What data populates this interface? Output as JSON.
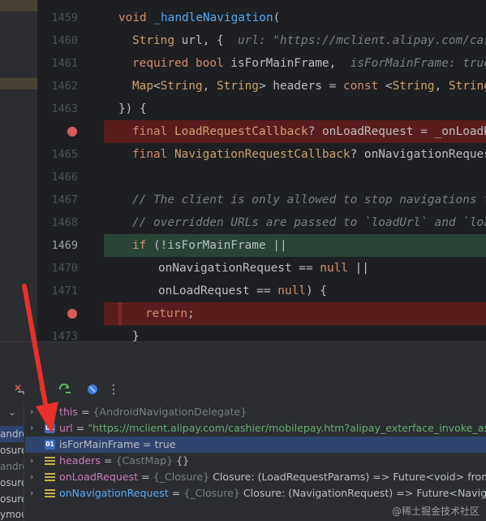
{
  "editor": {
    "lines": [
      {
        "num": "1459",
        "breakpoint": false,
        "highlight": "none"
      },
      {
        "num": "1460",
        "breakpoint": false,
        "highlight": "none"
      },
      {
        "num": "1461",
        "breakpoint": false,
        "highlight": "none"
      },
      {
        "num": "1462",
        "breakpoint": false,
        "highlight": "none"
      },
      {
        "num": "1463",
        "breakpoint": false,
        "highlight": "none"
      },
      {
        "num": "",
        "breakpoint": true,
        "highlight": "breakpoint"
      },
      {
        "num": "1465",
        "breakpoint": false,
        "highlight": "none"
      },
      {
        "num": "1466",
        "breakpoint": false,
        "highlight": "none"
      },
      {
        "num": "1467",
        "breakpoint": false,
        "highlight": "none"
      },
      {
        "num": "1468",
        "breakpoint": false,
        "highlight": "none"
      },
      {
        "num": "1469",
        "breakpoint": false,
        "highlight": "execution"
      },
      {
        "num": "1470",
        "breakpoint": false,
        "highlight": "none"
      },
      {
        "num": "1471",
        "breakpoint": false,
        "highlight": "none"
      },
      {
        "num": "",
        "breakpoint": true,
        "highlight": "breakpoint"
      },
      {
        "num": "1473",
        "breakpoint": false,
        "highlight": "none"
      }
    ],
    "code": {
      "l1459": {
        "kw": "void",
        "fn": "_handleNavigation",
        "rest": "("
      },
      "l1460": {
        "ty": "String",
        "pl": " url, {",
        "hint": "url: \"https://mclient.alipay.com/cashie"
      },
      "l1461": {
        "kw": "required",
        "kw2": "bool",
        "pl": " isForMainFrame,",
        "hint": "isForMainFrame: true"
      },
      "l1462": {
        "ty": "Map",
        "pl1": "<",
        "ty2": "String",
        "pl2": ", ",
        "ty3": "String",
        "pl3": "> headers = ",
        "kw": "const",
        "pl4": " <",
        "ty4": "String",
        "pl5": ", ",
        "ty5": "String",
        "pl6": ">{},"
      },
      "l1463": {
        "pl": "}) {"
      },
      "l1464": {
        "kw": "final",
        "ty": "LoadRequestCallback",
        "pl": "? onLoadRequest = _onLoadReque"
      },
      "l1465": {
        "kw": "final",
        "ty": "NavigationRequestCallback",
        "pl": "? onNavigationRequest = "
      },
      "l1467": {
        "cm": "// The client is only allowed to stop navigations that"
      },
      "l1468": {
        "cm": "// overridden URLs are passed to `loadUrl` and `loadUrl"
      },
      "l1469": {
        "kw": "if",
        "pl": " (!isForMainFrame ||"
      },
      "l1470": {
        "pl": "onNavigationRequest == ",
        "kw": "null",
        "pl2": " ||"
      },
      "l1471": {
        "pl": "onLoadRequest == ",
        "kw": "null",
        "pl2": ") {"
      },
      "l1472": {
        "kw": "return",
        "pl": ";"
      },
      "l1473": {
        "pl": "}"
      }
    }
  },
  "toolbar": {
    "icons": [
      "close-debug-icon",
      "step-icon",
      "refresh-icon",
      "dart-devtools-icon",
      "more-options-icon"
    ],
    "more_label": "⋮"
  },
  "frames": {
    "items": [
      {
        "label": "⌄",
        "selected": false,
        "dim": false
      },
      {
        "label": "android",
        "selected": true,
        "dim": false
      },
      {
        "label": "osure>",
        "selected": false,
        "dim": false
      },
      {
        "label": "android.",
        "selected": false,
        "dim": true
      },
      {
        "label": "osure>",
        "selected": false,
        "dim": false
      },
      {
        "label": "osure>",
        "selected": false,
        "dim": false
      },
      {
        "label": "ymou",
        "selected": false,
        "dim": false
      }
    ]
  },
  "variables": [
    {
      "chevron": "›",
      "icon": "field",
      "name": "this",
      "eq": " = ",
      "type": "{AndroidNavigationDelegate}",
      "value": "",
      "selected": false,
      "name_style": "purple"
    },
    {
      "chevron": "›",
      "icon": "prim",
      "name": "url",
      "eq": " = ",
      "type": "",
      "value": "\"https://mclient.alipay.com/cashier/mobilepay.htm?alipay_exterface_invoke_assig",
      "selected": false,
      "name_style": "purple"
    },
    {
      "chevron": "",
      "icon": "prim",
      "name": "isForMainFrame",
      "eq": " = ",
      "type": "",
      "value": "true",
      "selected": true,
      "name_style": "plain"
    },
    {
      "chevron": "›",
      "icon": "field",
      "name": "headers",
      "eq": " = ",
      "type": "{CastMap}",
      "value": " {}",
      "selected": false,
      "name_style": "purple"
    },
    {
      "chevron": "›",
      "icon": "field",
      "name": "onLoadRequest",
      "eq": " = ",
      "type": "{_Closure}",
      "value": " Closure: (LoadRequestParams) => Future<void> from Fu",
      "selected": false,
      "name_style": "purple"
    },
    {
      "chevron": "›",
      "icon": "field",
      "name": "onNavigationRequest",
      "eq": " = ",
      "type": "{_Closure}",
      "value": " Closure: (NavigationRequest) => Future<Navigation",
      "selected": false,
      "name_style": "blue"
    }
  ],
  "prim_icon_text": "01",
  "watermark": "@稀土掘金技术社区",
  "colors": {
    "breakpoint_line": "#5a1d1d",
    "execution_line": "#294436",
    "breakpoint_dot": "#db5c5c",
    "arrow": "#e8312a",
    "selection": "#2e436e"
  }
}
